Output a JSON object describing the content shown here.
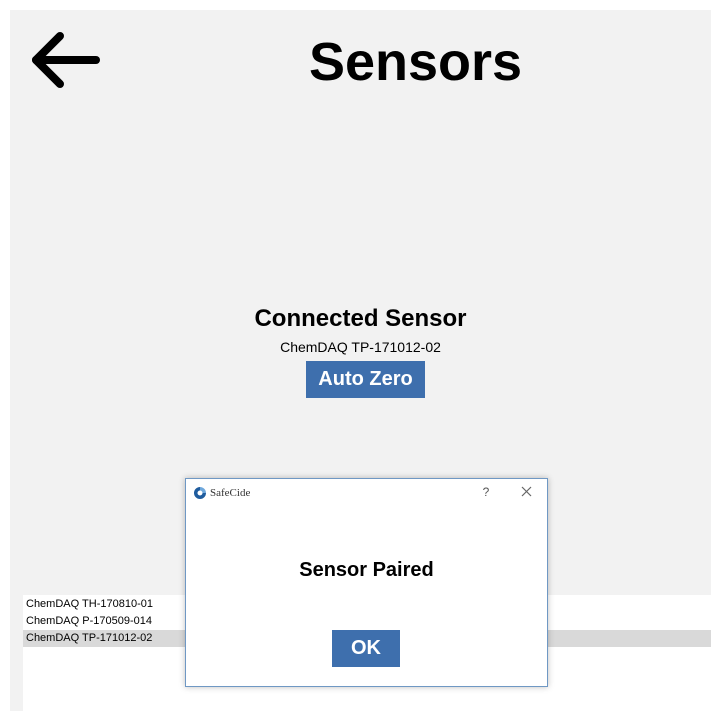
{
  "header": {
    "title": "Sensors",
    "back_icon": "arrow-left-icon"
  },
  "connected": {
    "heading": "Connected Sensor",
    "sensor_name": "ChemDAQ TP-171012-02",
    "auto_zero_label": "Auto Zero"
  },
  "sensor_list": {
    "items": [
      {
        "label": "ChemDAQ TH-170810-01",
        "selected": false
      },
      {
        "label": "ChemDAQ P-170509-014",
        "selected": false
      },
      {
        "label": "ChemDAQ TP-171012-02",
        "selected": true
      }
    ]
  },
  "dialog": {
    "app_name": "SafeCide",
    "app_icon": "safecide-logo-icon",
    "help_label": "?",
    "close_icon": "close-icon",
    "message": "Sensor Paired",
    "ok_label": "OK"
  },
  "colors": {
    "accent": "#3e6fad",
    "background": "#f2f2f2",
    "selected_row": "#d9d9d9"
  }
}
